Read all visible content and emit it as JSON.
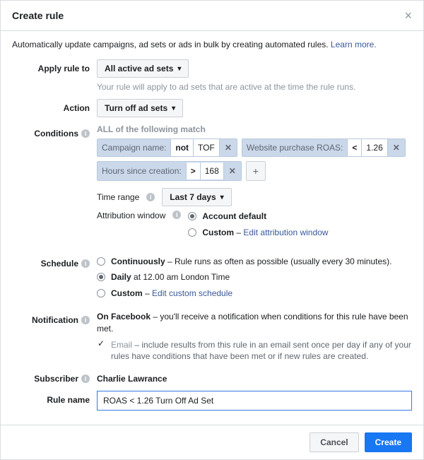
{
  "header": {
    "title": "Create rule",
    "close_glyph": "×"
  },
  "intro": {
    "text": "Automatically update campaigns, ad sets or ads in bulk by creating automated rules. ",
    "link": "Learn more."
  },
  "apply": {
    "label": "Apply rule to",
    "value": "All active ad sets",
    "hint": "Your rule will apply to ad sets that are active at the time the rule runs."
  },
  "action": {
    "label": "Action",
    "value": "Turn off ad sets"
  },
  "conditions": {
    "label": "Conditions",
    "heading": "ALL of the following match",
    "chips": [
      {
        "key": "Campaign name:",
        "op": "not",
        "val": "TOF"
      },
      {
        "key": "Website purchase ROAS:",
        "op": "<",
        "val": "1.26"
      },
      {
        "key": "Hours since creation:",
        "op": ">",
        "val": "168"
      }
    ],
    "plus": "+",
    "time_range": {
      "label": "Time range",
      "value": "Last 7 days"
    },
    "attr_window": {
      "label": "Attribution window",
      "options": [
        {
          "text": "Account default",
          "selected": true
        },
        {
          "text": "Custom",
          "suffix_sep": " – ",
          "link": "Edit attribution window",
          "selected": false
        }
      ]
    }
  },
  "schedule": {
    "label": "Schedule",
    "options": [
      {
        "bold": "Continuously",
        "text": " – Rule runs as often as possible (usually every 30 minutes).",
        "selected": false
      },
      {
        "bold": "Daily",
        "text": " at 12.00 am London Time",
        "selected": true
      },
      {
        "bold": "Custom",
        "suffix_sep": " – ",
        "link": "Edit custom schedule",
        "selected": false
      }
    ]
  },
  "notification": {
    "label": "Notification",
    "primary_bold": "On Facebook",
    "primary_text": " – you'll receive a notification when conditions for this rule have been met.",
    "email_label": "Email",
    "email_text": " – include results from this rule in an email sent once per day if any of your rules have conditions that have been met or if new rules are created.",
    "email_check": "✓"
  },
  "subscriber": {
    "label": "Subscriber",
    "value": "Charlie Lawrance"
  },
  "rulename": {
    "label": "Rule name",
    "value": "ROAS < 1.26 Turn Off Ad Set"
  },
  "footer": {
    "cancel": "Cancel",
    "create": "Create"
  },
  "glyphs": {
    "caret": "▾",
    "x": "✕",
    "i": "i"
  }
}
